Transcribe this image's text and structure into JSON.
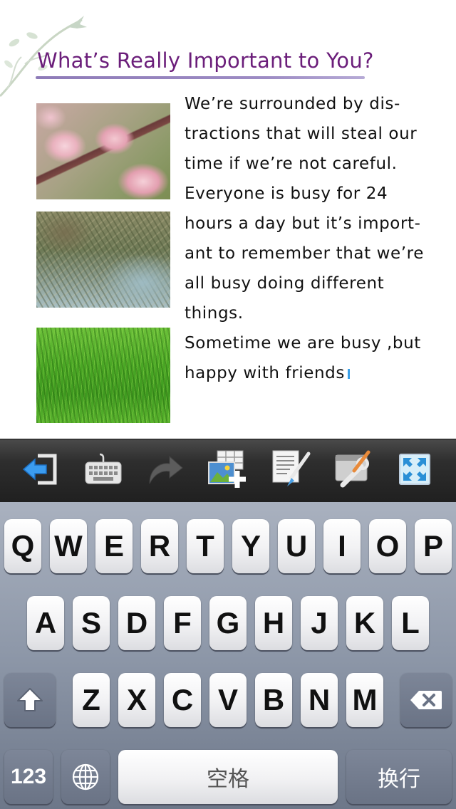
{
  "document": {
    "title": "What’s Really Important to You?",
    "body_lines": [
      "We’re surrounded by dis-",
      "tractions that will steal our",
      "time if we’re not careful.",
      "Everyone is busy for 24",
      "hours a day but it’s import-",
      "ant to remember that we’re",
      "all busy doing different",
      "things.",
      "Sometime we are busy ,but",
      "happy with friends"
    ],
    "images": [
      "cherry-blossom-photo",
      "tree-branches-photo",
      "grass-photo"
    ],
    "title_color": "#6b1e7a",
    "rule_color": "#8e7bb8"
  },
  "toolbar": {
    "buttons": [
      "exit-icon",
      "keyboard-icon",
      "redo-icon",
      "insert-image-icon",
      "edit-text-icon",
      "tools-icon",
      "fullscreen-icon"
    ]
  },
  "keyboard": {
    "row1": [
      "Q",
      "W",
      "E",
      "R",
      "T",
      "Y",
      "U",
      "I",
      "O",
      "P"
    ],
    "row2": [
      "A",
      "S",
      "D",
      "F",
      "G",
      "H",
      "J",
      "K",
      "L"
    ],
    "row3": [
      "Z",
      "X",
      "C",
      "V",
      "B",
      "N",
      "M"
    ],
    "numbers_label": "123",
    "space_label": "空格",
    "return_label": "换行"
  }
}
